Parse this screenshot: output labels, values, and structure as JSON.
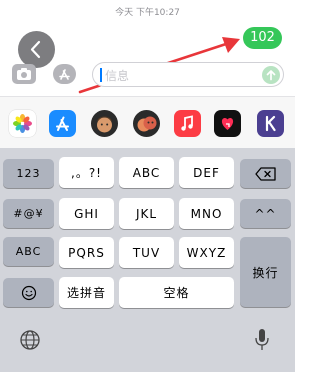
{
  "status": {
    "timestamp": "今天 下午10:27"
  },
  "message": {
    "bubble_text": "102"
  },
  "compose": {
    "placeholder": "信息"
  },
  "app_strip": {
    "apps": [
      "photos-app",
      "app-store-app",
      "memoji-app",
      "memoji-stickers-app",
      "music-app",
      "digital-touch-app",
      "k-app"
    ]
  },
  "keyboard": {
    "row1": [
      "123",
      ",。?!",
      "ABC",
      "DEF"
    ],
    "row2": [
      "#@¥",
      "GHI",
      "JKL",
      "MNO",
      "^^"
    ],
    "row3": [
      "ABC",
      "PQRS",
      "TUV",
      "WXYZ"
    ],
    "row4": [
      "选拼音",
      "空格"
    ],
    "return_label": "换行"
  },
  "colors": {
    "bubble_green": "#35c759",
    "annotation_red": "#e8363a",
    "keyboard_bg": "#d2d4da"
  }
}
